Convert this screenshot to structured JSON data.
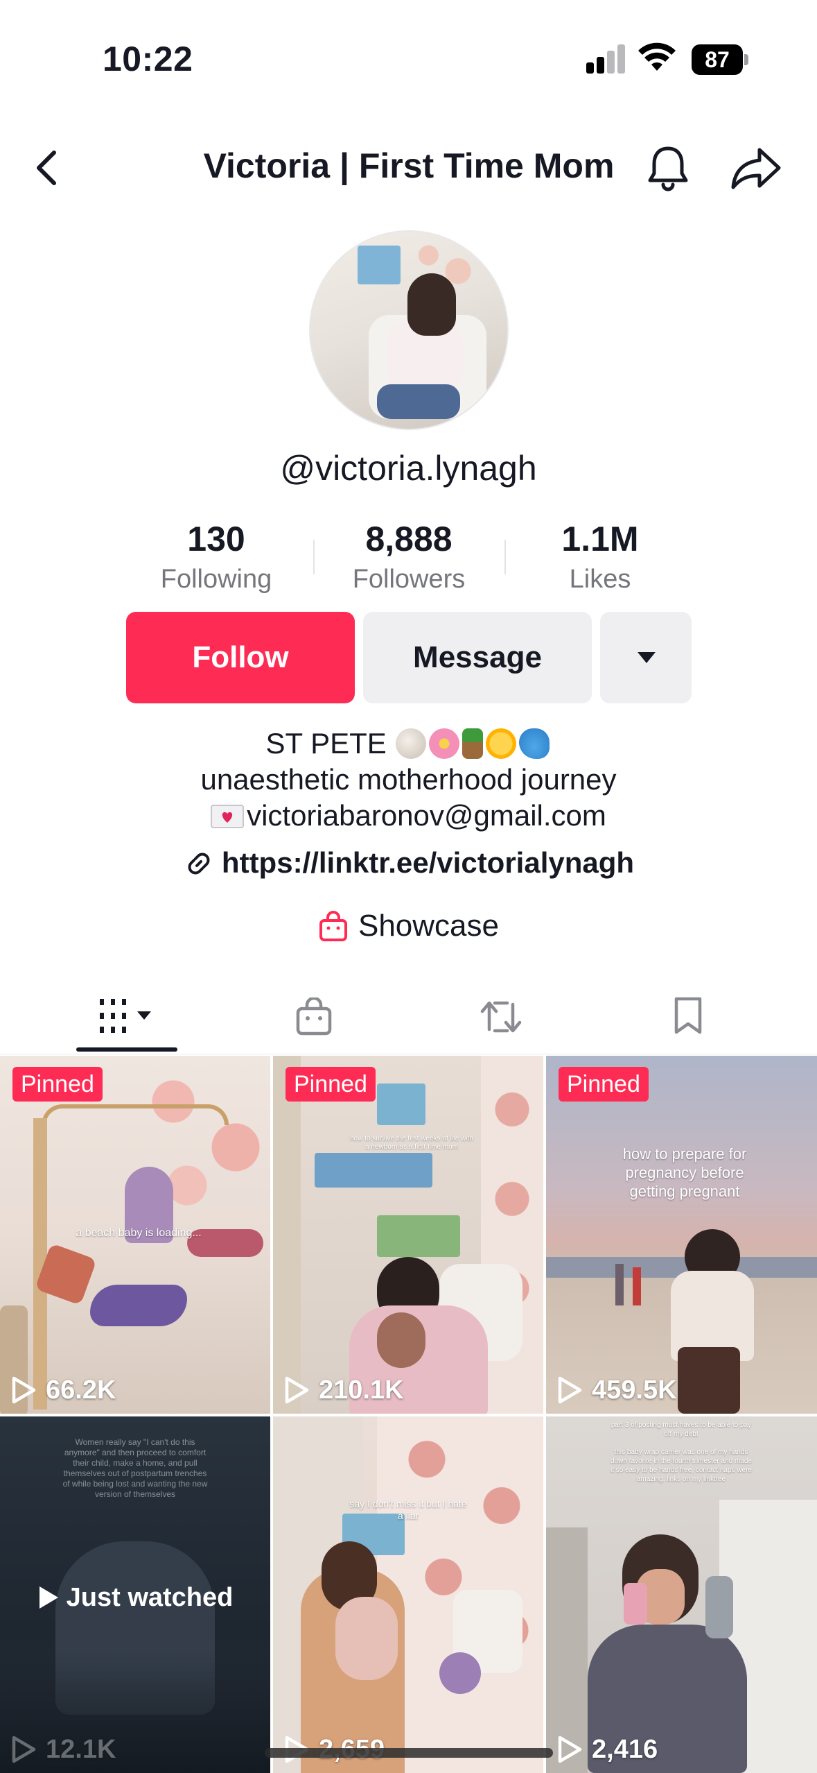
{
  "status_bar": {
    "time": "10:22",
    "battery": "87"
  },
  "header": {
    "title": "Victoria | First Time Mom"
  },
  "profile": {
    "username": "@victoria.lynagh",
    "stats": [
      {
        "value": "130",
        "label": "Following"
      },
      {
        "value": "8,888",
        "label": "Followers"
      },
      {
        "value": "1.1M",
        "label": "Likes"
      }
    ],
    "follow_label": "Follow",
    "message_label": "Message",
    "bio": {
      "line1": "ST PETE",
      "line2": "unaesthetic motherhood journey",
      "line3": "victoriabaronov@gmail.com"
    },
    "link": "https://linktr.ee/victorialynagh",
    "showcase_label": "Showcase"
  },
  "tabs": [
    {
      "name": "videos",
      "icon": "grid-icon"
    },
    {
      "name": "shop",
      "icon": "shopping-bag-icon"
    },
    {
      "name": "reposts",
      "icon": "repost-icon"
    },
    {
      "name": "favorites",
      "icon": "bookmark-icon"
    }
  ],
  "videos": [
    {
      "pinned": "Pinned",
      "views": "66.2K",
      "caption": "a beach baby is loading..."
    },
    {
      "pinned": "Pinned",
      "views": "210.1K",
      "caption": "how to survive the first weeks of life with a newborn as a first time mom"
    },
    {
      "pinned": "Pinned",
      "views": "459.5K",
      "caption": "how to prepare for pregnancy before getting pregnant"
    },
    {
      "views": "12.1K",
      "overlay": "Just watched",
      "caption": "Women really say \"I can't do this anymore\" and then proceed to comfort their child, make a home, and pull themselves out of postpartum trenches of while being lost and wanting the new version of themselves"
    },
    {
      "views": "2,659",
      "caption": "say I don't miss it but I hate a liar"
    },
    {
      "views": "2,416",
      "caption": "part 3 of posting must haves to be able to pay off my debt\n\nthis baby wrap carrier was one of my hands down favorite in the fourth trimester and made it so easy to be hands free, contact naps were amazing. links on my linktree"
    }
  ],
  "colors": {
    "accent": "#fe2c55",
    "button_gray": "#efeff1",
    "text": "#161823",
    "muted": "#75767c"
  }
}
